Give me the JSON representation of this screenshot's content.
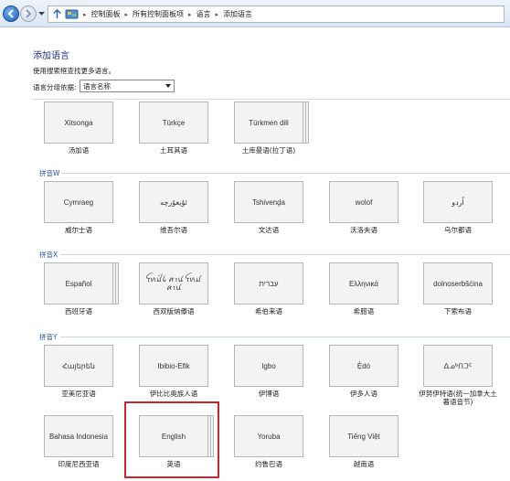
{
  "breadcrumb": [
    "控制面板",
    "所有控制面板项",
    "语言",
    "添加语言"
  ],
  "page": {
    "title": "添加语言",
    "hint": "使用搜索框查找更多语言。",
    "group_by_label": "语言分组依据:",
    "group_by_value": "语言名称"
  },
  "sections": {
    "w": "拼音W",
    "x": "拼音X",
    "y": "拼音Y"
  },
  "tiles": {
    "ts": {
      "native": "Xitsonga",
      "zh": "汤加语"
    },
    "tr": {
      "native": "Türkçe",
      "zh": "土耳其语"
    },
    "tk": {
      "native": "Türkmen dili",
      "zh": "土库曼语(拉丁语)"
    },
    "cy": {
      "native": "Cymraeg",
      "zh": "威尔士语"
    },
    "ug": {
      "native": "ئۇيغۇرچە",
      "zh": "维吾尔语"
    },
    "ve": {
      "native": "Tshivenḓa",
      "zh": "文达语"
    },
    "wo": {
      "native": "wolof",
      "zh": "沃洛夫语"
    },
    "ur": {
      "native": "اُردو",
      "zh": "乌尔都语"
    },
    "es": {
      "native": "Español",
      "zh": "西班牙语"
    },
    "sy": {
      "native": "ꪼꪕꪣꪾꪉ ꪁꪱꪙ ꪼꪕꪣ ꪁꪱꪙ",
      "zh": "西双版纳傣语"
    },
    "he": {
      "native": "עברית",
      "zh": "希伯来语"
    },
    "el": {
      "native": "Ελληνικά",
      "zh": "希腊语"
    },
    "dsb": {
      "native": "dolnoserbšćina",
      "zh": "下索布语"
    },
    "hy": {
      "native": "Հայերեն",
      "zh": "亚美尼亚语"
    },
    "ibb": {
      "native": "Ibibio-Efik",
      "zh": "伊比比奥族人语"
    },
    "ig": {
      "native": "Igbo",
      "zh": "伊博语"
    },
    "bin": {
      "native": "Ẹ̀dó",
      "zh": "伊多人语"
    },
    "iu": {
      "native": "ᐃᓄᒃᑎᑐᑦ",
      "zh": "伊努伊特语(统一加拿大土著语音节)"
    },
    "id": {
      "native": "Bahasa Indonesia",
      "zh": "印度尼西亚语"
    },
    "en": {
      "native": "English",
      "zh": "英语"
    },
    "yo": {
      "native": "Yoruba",
      "zh": "约鲁巴语"
    },
    "vi": {
      "native": "Tiếng Việt",
      "zh": "越南语"
    }
  }
}
